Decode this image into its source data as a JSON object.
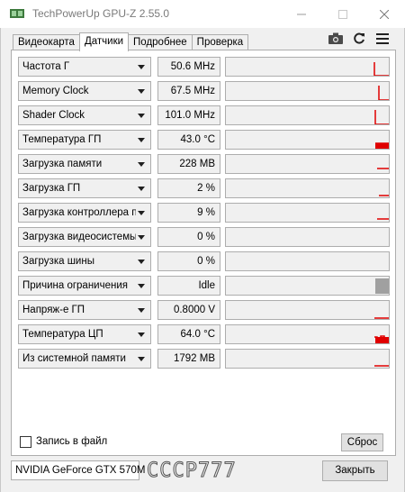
{
  "window": {
    "title": "TechPowerUp GPU-Z 2.55.0",
    "minimize_icon": "minimize-icon",
    "maximize_icon": "maximize-icon",
    "close_icon": "close-icon"
  },
  "tabs": [
    {
      "label": "Видеокарта",
      "active": false
    },
    {
      "label": "Датчики",
      "active": true
    },
    {
      "label": "Подробнее",
      "active": false
    },
    {
      "label": "Проверка",
      "active": false
    }
  ],
  "toolbar": {
    "camera_icon": "camera-icon",
    "refresh_icon": "refresh-icon",
    "menu_icon": "hamburger-menu-icon"
  },
  "sensors": [
    {
      "label": "Частота Г",
      "value": "50.6 MHz"
    },
    {
      "label": "Memory Clock",
      "value": "67.5 MHz"
    },
    {
      "label": "Shader Clock",
      "value": "101.0 MHz"
    },
    {
      "label": "Температура ГП",
      "value": "43.0 °C"
    },
    {
      "label": "Загрузка памяти",
      "value": "228 MB"
    },
    {
      "label": "Загрузка ГП",
      "value": "2 %"
    },
    {
      "label": "Загрузка контроллера памяти",
      "value": "9 %"
    },
    {
      "label": "Загрузка видеосистемы",
      "value": "0 %"
    },
    {
      "label": "Загрузка шины",
      "value": "0 %"
    },
    {
      "label": "Причина ограничения",
      "value": "Idle"
    },
    {
      "label": "Напряж-е ГП",
      "value": "0.8000 V"
    },
    {
      "label": "Температура ЦП",
      "value": "64.0 °C"
    },
    {
      "label": "Из системной памяти",
      "value": "1792 MB"
    }
  ],
  "footer": {
    "log_label": "Запись в файл",
    "log_checked": false,
    "reset_label": "Сброс",
    "gpu_name": "NVIDIA GeForce GTX 570M",
    "close_label": "Закрыть"
  },
  "colors": {
    "graph_line": "#e00000",
    "limit_bar": "#a0a0a0"
  }
}
